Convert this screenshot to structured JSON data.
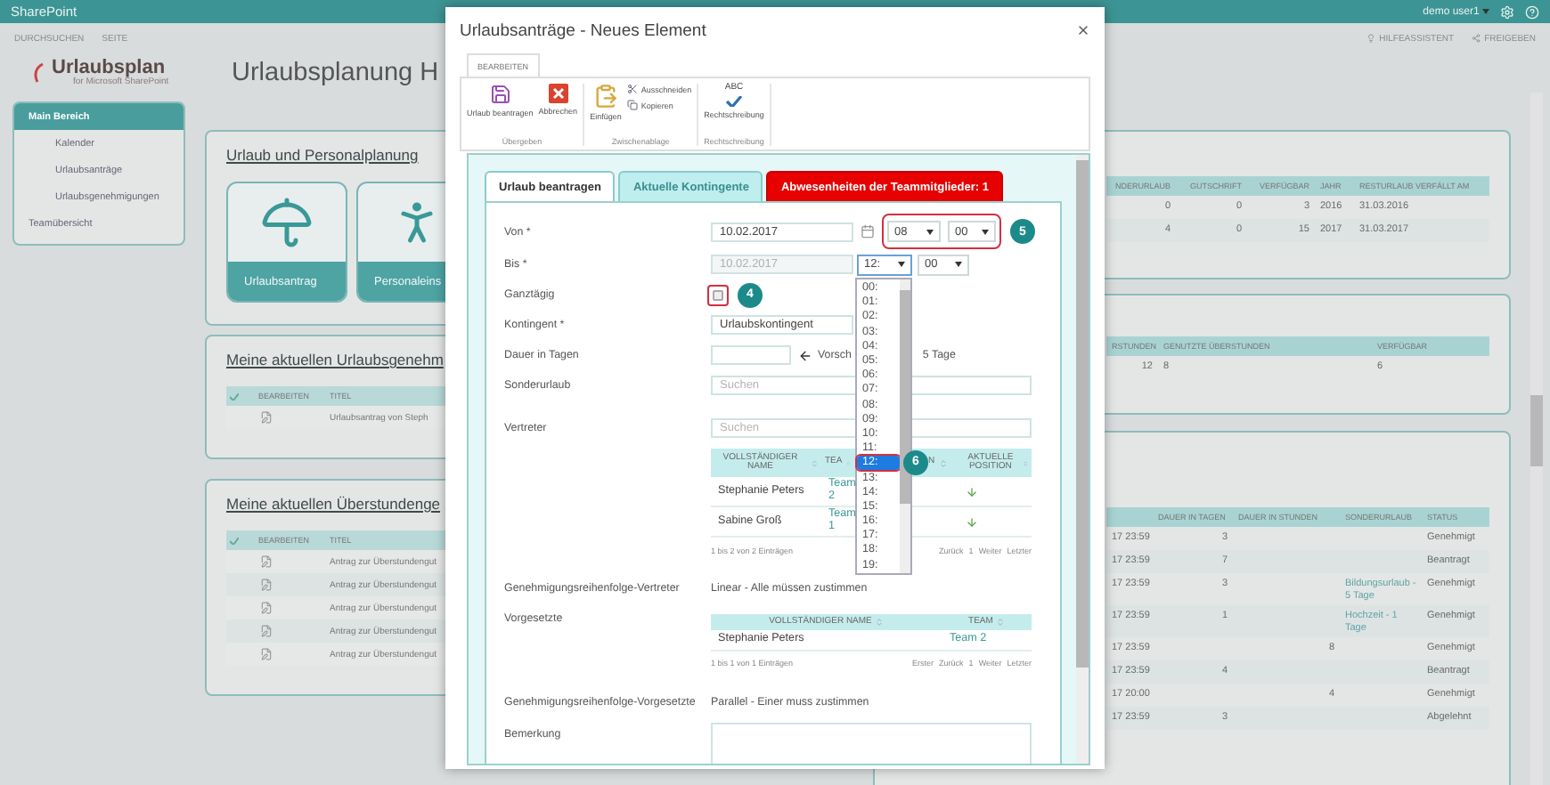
{
  "top_bar": {
    "brand": "SharePoint",
    "user": "demo user1"
  },
  "sub_bar": {
    "tabs": [
      "DURCHSUCHEN",
      "SEITE"
    ],
    "actions": [
      "HILFEASSISTENT",
      "FREIGEBEN"
    ]
  },
  "logo": {
    "name": "Urlaubsplan",
    "tagline": "for Microsoft SharePoint"
  },
  "page_title": "Urlaubsplanung H",
  "nav": [
    {
      "label": "Main Bereich",
      "selected": true,
      "children": [
        {
          "label": "Kalender",
          "selected": false
        },
        {
          "label": "Urlaubsanträge",
          "selected": false
        },
        {
          "label": "Urlaubsgenehmigungen",
          "selected": false
        }
      ]
    },
    {
      "label": "Teamübersicht",
      "selected": false
    }
  ],
  "planning_card": {
    "title": "Urlaub und Personalplanung",
    "tiles": [
      {
        "kind": "vacation",
        "label": "Urlaubsantrag"
      },
      {
        "kind": "staff",
        "label": "Personaleins"
      }
    ]
  },
  "approvals_card": {
    "title": "Meine aktuellen Urlaubsgenehm",
    "columns": [
      "BEARBEITEN",
      "TITEL"
    ],
    "rows": [
      "Urlaubsantrag von Steph"
    ]
  },
  "overtime_card": {
    "title": "Meine aktuellen Überstundenge",
    "columns": [
      "BEARBEITEN",
      "TITEL"
    ],
    "rows": [
      "Antrag zur Überstundengut",
      "Antrag zur Überstundengut",
      "Antrag zur Überstundengut",
      "Antrag zur Überstundengut",
      "Antrag zur Überstundengut"
    ]
  },
  "quota_table": {
    "columns": [
      "NDERURLAUB",
      "GUTSCHRIFT",
      "VERFÜGBAR",
      "JAHR",
      "RESTURLAUB VERFÄLLT AM"
    ],
    "rows": [
      [
        "0",
        "0",
        "3",
        "2016",
        "31.03.2016"
      ],
      [
        "4",
        "0",
        "15",
        "2017",
        "31.03.2017"
      ]
    ]
  },
  "overtime_table": {
    "columns": [
      "RSTUNDEN",
      "GENUTZTE ÜBERSTUNDEN",
      "VERFÜGBAR"
    ],
    "rows": [
      [
        "12",
        "8",
        "6"
      ]
    ]
  },
  "requests_table": {
    "columns": [
      "DAUER IN TAGEN",
      "DAUER IN STUNDEN",
      "SONDERURLAUB",
      "STATUS"
    ],
    "rows": [
      {
        "end": "17 23:59",
        "days": "3",
        "status": "Genehmigt"
      },
      {
        "end": "17 23:59",
        "days": "7",
        "status": "Beantragt"
      },
      {
        "end": "17 23:59",
        "days": "3",
        "special": "Bildungsurlaub - 5 Tage",
        "status": "Genehmigt"
      },
      {
        "end": "17 23:59",
        "days": "1",
        "special": "Hochzeit - 1 Tage",
        "status": "Genehmigt"
      },
      {
        "end": "17 23:59",
        "hours": "8",
        "status": "Genehmigt"
      },
      {
        "end": "17 23:59",
        "days": "4",
        "status": "Beantragt"
      },
      {
        "end": "17 20:00",
        "hours": "4",
        "status": "Genehmigt"
      },
      {
        "end": "17 23:59",
        "days": "3",
        "status": "Abgelehnt"
      }
    ]
  },
  "dialog": {
    "title": "Urlaubsanträge - Neues Element",
    "ribbon_tab": "BEARBEITEN",
    "groups": [
      {
        "label": "Übergeben",
        "buttons": [
          {
            "kind": "save",
            "label": "Urlaub beantragen"
          },
          {
            "kind": "cancel",
            "label": "Abbrechen"
          }
        ]
      },
      {
        "label": "Zwischenablage",
        "buttons": [
          {
            "kind": "paste",
            "label": "Einfügen"
          },
          {
            "kind": "cut",
            "label": "Ausschneiden"
          },
          {
            "kind": "copy",
            "label": "Kopieren"
          }
        ]
      },
      {
        "label": "Rechtschreibung",
        "buttons": [
          {
            "kind": "spelling",
            "label": "Rechtschreibung",
            "icon_text": "ABC"
          }
        ]
      }
    ],
    "tabs": [
      {
        "label": "Urlaub beantragen",
        "selected": true,
        "kind": "normal"
      },
      {
        "label": "Aktuelle Kontingente",
        "selected": false,
        "kind": "normal"
      },
      {
        "label": "Abwesenheiten der Teammitglieder: 1",
        "selected": false,
        "kind": "alert"
      }
    ],
    "from": {
      "label": "Von *",
      "date": "10.02.2017",
      "hour": "08",
      "minute": "00",
      "callout": "5"
    },
    "to": {
      "label": "Bis *",
      "date": "10.02.2017",
      "date_disabled": true,
      "hour": "12:",
      "minute": "00",
      "callout": "6",
      "hour_options": [
        {
          "label": "00:",
          "selected": false
        },
        {
          "label": "01:",
          "selected": false
        },
        {
          "label": "02:",
          "selected": false
        },
        {
          "label": "03:",
          "selected": false
        },
        {
          "label": "04:",
          "selected": false
        },
        {
          "label": "05:",
          "selected": false
        },
        {
          "label": "06:",
          "selected": false
        },
        {
          "label": "07:",
          "selected": false
        },
        {
          "label": "08:",
          "selected": false
        },
        {
          "label": "09:",
          "selected": false
        },
        {
          "label": "10:",
          "selected": false
        },
        {
          "label": "11:",
          "selected": false
        },
        {
          "label": "12:",
          "selected": true
        },
        {
          "label": "13:",
          "selected": false
        },
        {
          "label": "14:",
          "selected": false
        },
        {
          "label": "15:",
          "selected": false
        },
        {
          "label": "16:",
          "selected": false
        },
        {
          "label": "17:",
          "selected": false
        },
        {
          "label": "18:",
          "selected": false
        },
        {
          "label": "19:",
          "selected": false
        }
      ]
    },
    "all_day": {
      "label": "Ganztägig",
      "checked": false,
      "callout": "4"
    },
    "quota": {
      "label": "Kontingent *",
      "value": "Urlaubskontingent"
    },
    "duration": {
      "label": "Dauer in Tagen",
      "suggestion": "Vorsch",
      "suggestion_end": "5 Tage"
    },
    "special_leave": {
      "label": "Sonderurlaub",
      "placeholder": "Suchen"
    },
    "deputies": {
      "label": "Vertreter",
      "placeholder": "Suchen",
      "columns": [
        "VOLLSTÄNDIGER NAME",
        "TEA",
        "N",
        "AKTUELLE POSITION"
      ],
      "rows": [
        {
          "name": "Stephanie Peters",
          "team": "Team 2"
        },
        {
          "name": "Sabine Groß",
          "team": "Team 1"
        }
      ],
      "info": "1 bis 2 von 2 Einträgen",
      "pager": [
        "Zurück",
        "1",
        "Weiter",
        "Letzter"
      ]
    },
    "approval_order_deputies": {
      "label": "Genehmigungsreihenfolge-Vertreter",
      "value": "Linear - Alle müssen zustimmen"
    },
    "supervisors": {
      "label": "Vorgesetzte",
      "columns": [
        "VOLLSTÄNDIGER NAME",
        "TEAM"
      ],
      "rows": [
        {
          "name": "Stephanie Peters",
          "team": "Team 2"
        }
      ],
      "info": "1 bis 1 von 1 Einträgen",
      "pager": [
        "Erster",
        "Zurück",
        "1",
        "Weiter",
        "Letzter"
      ]
    },
    "approval_order_supervisors": {
      "label": "Genehmigungsreihenfolge-Vorgesetzte",
      "value": "Parallel - Einer muss zustimmen"
    },
    "remark": {
      "label": "Bemerkung"
    }
  }
}
